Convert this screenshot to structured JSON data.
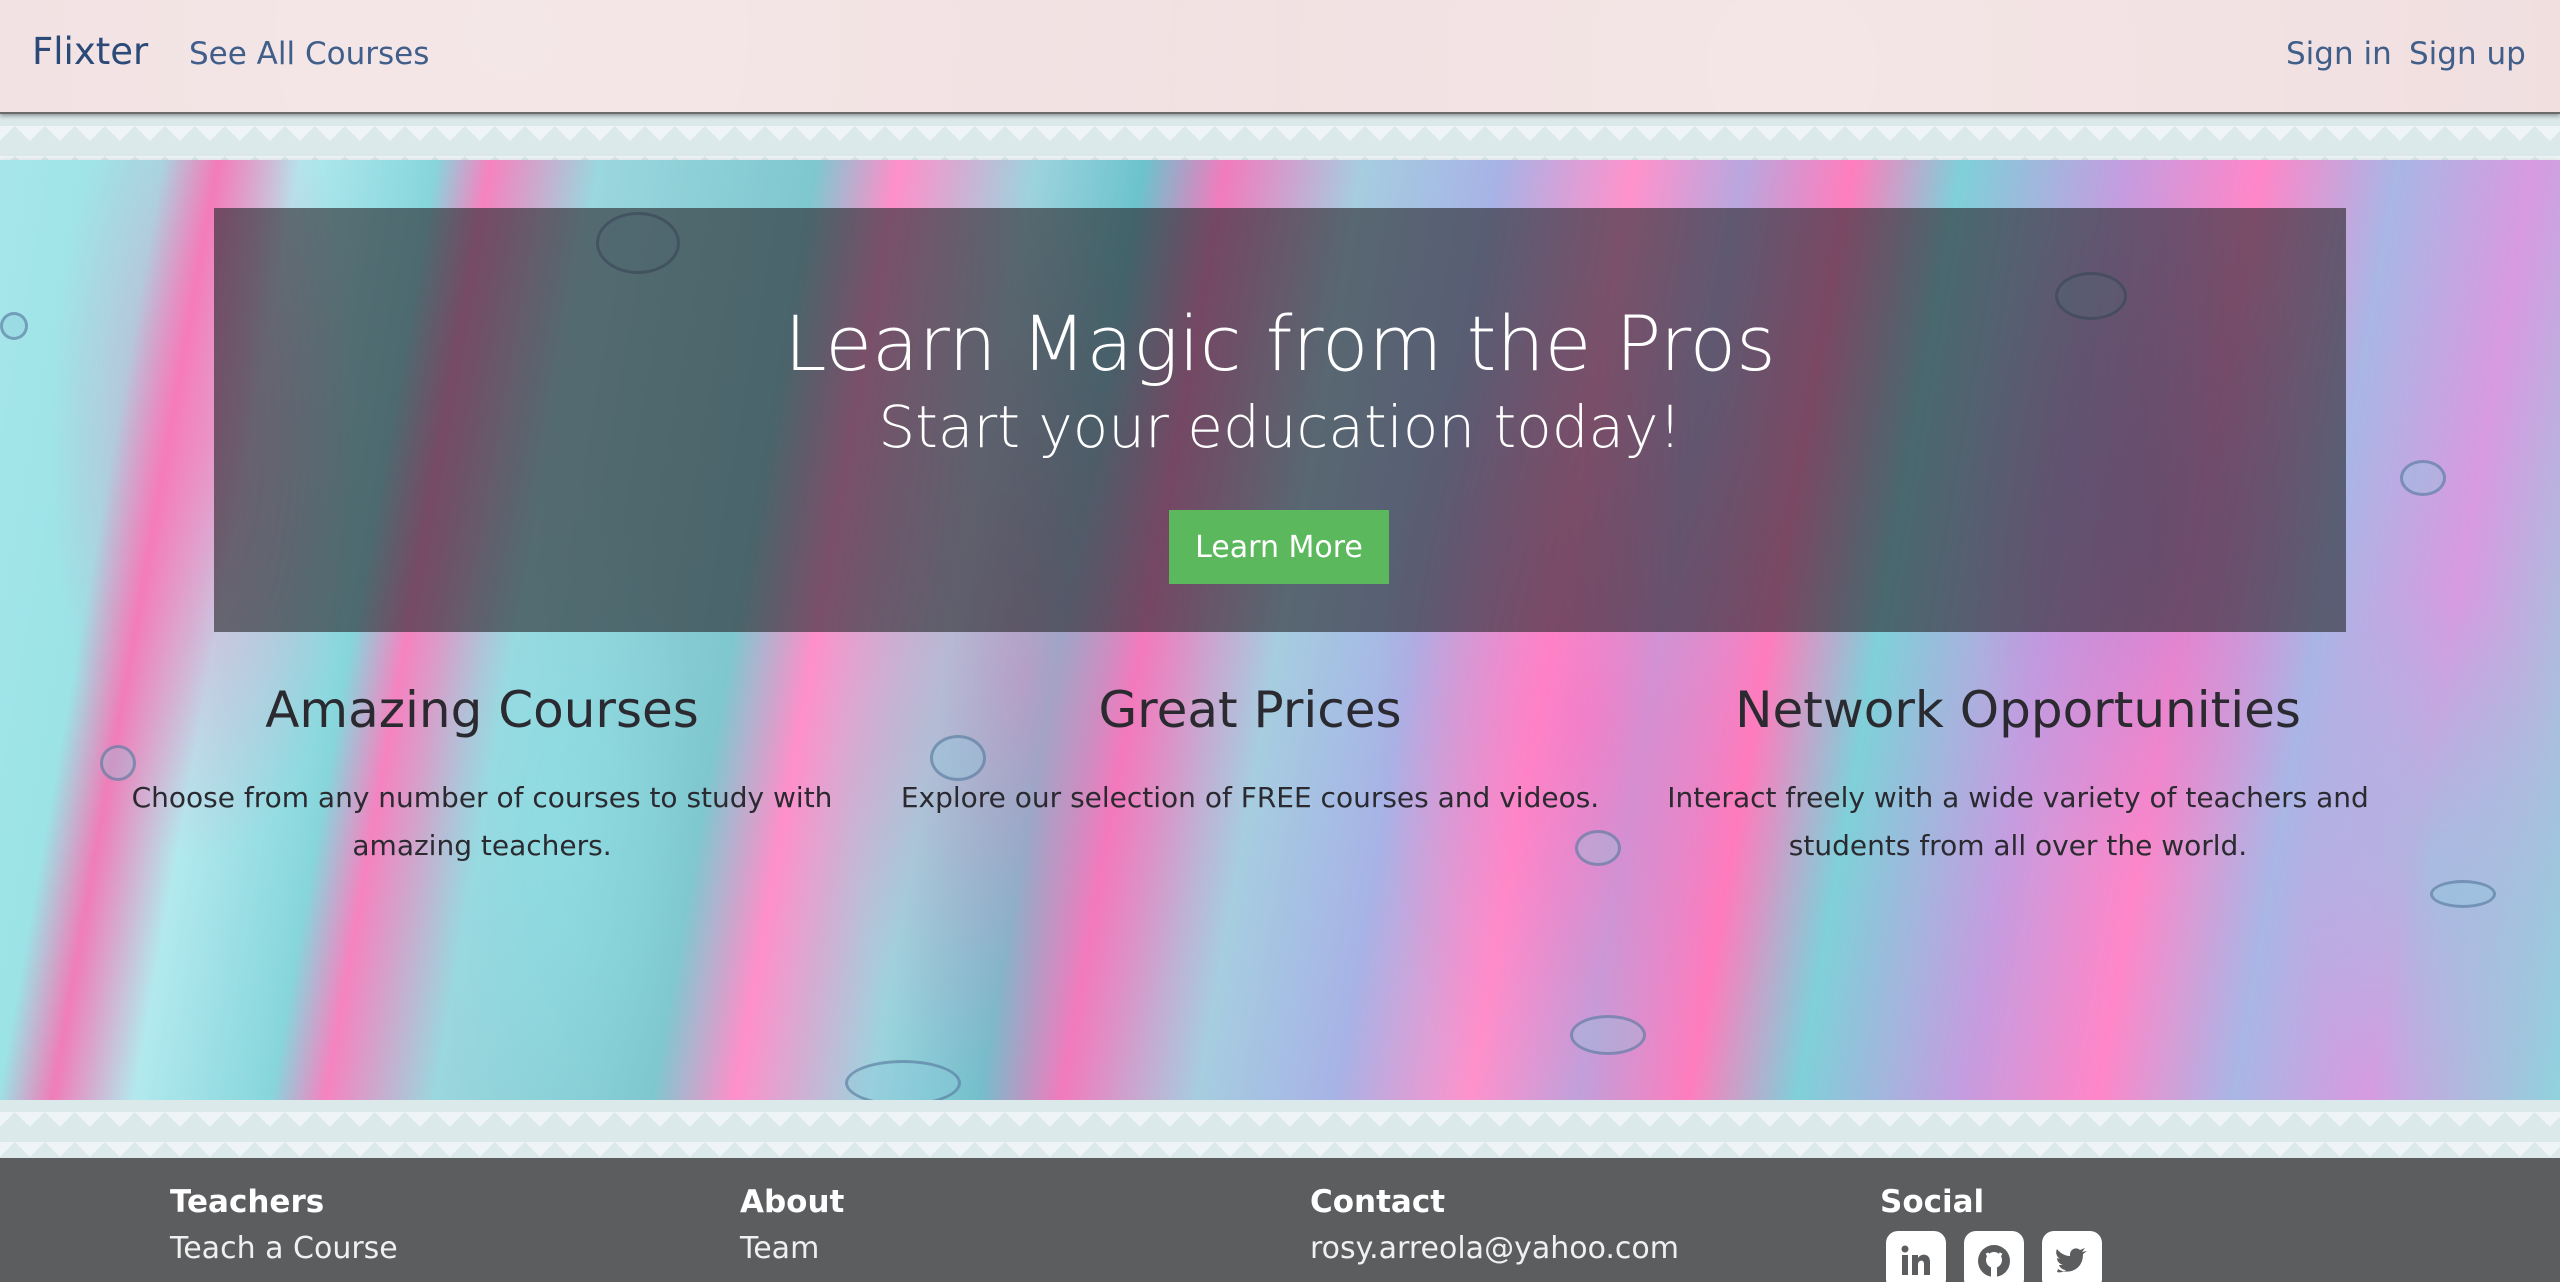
{
  "navbar": {
    "brand": "Flixter",
    "see_all_courses": "See All Courses",
    "sign_in": "Sign in",
    "sign_up": "Sign up"
  },
  "hero": {
    "title": "Learn Magic from the Pros",
    "subtitle": "Start your education today!",
    "cta_label": "Learn More"
  },
  "features": [
    {
      "heading": "Amazing Courses",
      "text": "Choose from any number of courses to study with amazing teachers."
    },
    {
      "heading": "Great Prices",
      "text": "Explore our selection of FREE courses and videos."
    },
    {
      "heading": "Network Opportunities",
      "text": "Interact freely with a wide variety of teachers and students from all over the world."
    }
  ],
  "footer": {
    "teachers": {
      "heading": "Teachers",
      "link": "Teach a Course"
    },
    "about": {
      "heading": "About",
      "link": "Team"
    },
    "contact": {
      "heading": "Contact",
      "email": "rosy.arreola@yahoo.com"
    },
    "social": {
      "heading": "Social",
      "icons": [
        "linkedin-icon",
        "github-icon",
        "twitter-icon"
      ]
    }
  },
  "colors": {
    "navbar_bg": "#f1dfe0",
    "brand": "#2b4a78",
    "cta": "#5cb85c",
    "footer_bg": "#5c5d5e"
  }
}
